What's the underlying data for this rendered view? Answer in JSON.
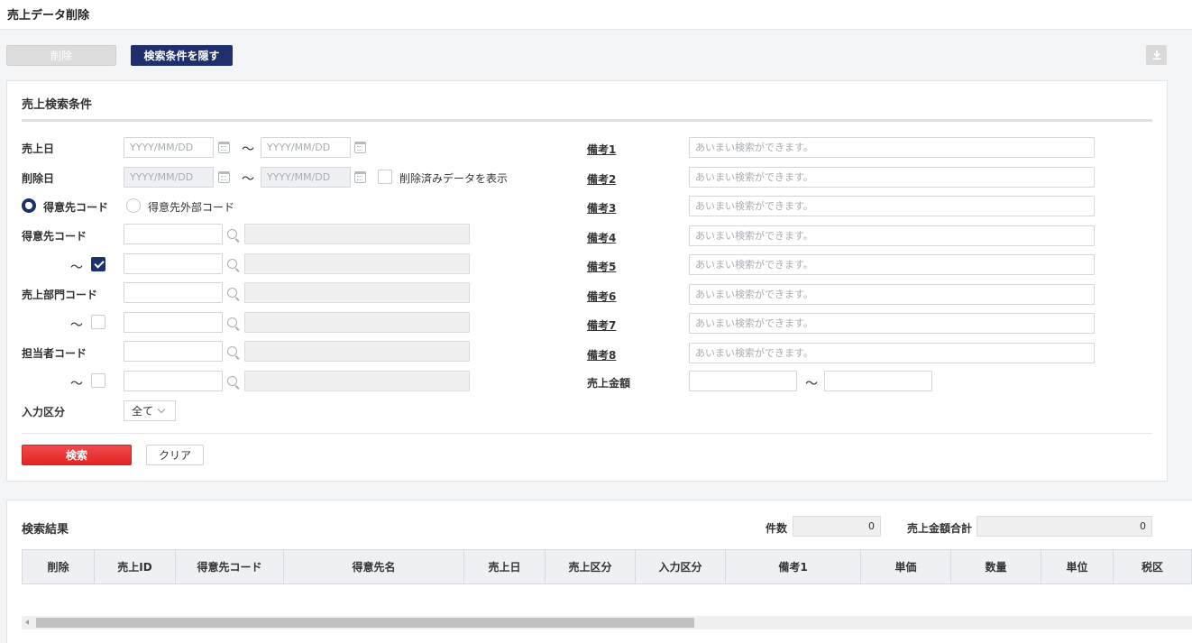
{
  "page": {
    "title": "売上データ削除"
  },
  "toolbar": {
    "delete_label": "削除",
    "toggle_label": "検索条件を隠す"
  },
  "search": {
    "title": "売上検索条件",
    "sales_date_label": "売上日",
    "delete_date_label": "削除日",
    "date_placeholder": "YYYY/MM/DD",
    "tilde": "～",
    "show_deleted_label": "削除済みデータを表示",
    "radio_customer_code": "得意先コード",
    "radio_external_code": "得意先外部コード",
    "customer_code_label": "得意先コード",
    "dept_code_label": "売上部門コード",
    "staff_code_label": "担当者コード",
    "input_type_label": "入力区分",
    "input_type_value": "全て",
    "remarks": [
      "備考1",
      "備考2",
      "備考3",
      "備考4",
      "備考5",
      "備考6",
      "備考7",
      "備考8"
    ],
    "remarks_placeholder": "あいまい検索ができます。",
    "amount_label": "売上金額",
    "search_button": "検索",
    "clear_button": "クリア"
  },
  "results": {
    "title": "検索結果",
    "count_label": "件数",
    "count_value": "0",
    "total_label": "売上金額合計",
    "total_value": "0",
    "columns": [
      "削除",
      "売上ID",
      "得意先コード",
      "得意先名",
      "売上日",
      "売上区分",
      "入力区分",
      "備考1",
      "単価",
      "数量",
      "単位",
      "税区"
    ]
  }
}
